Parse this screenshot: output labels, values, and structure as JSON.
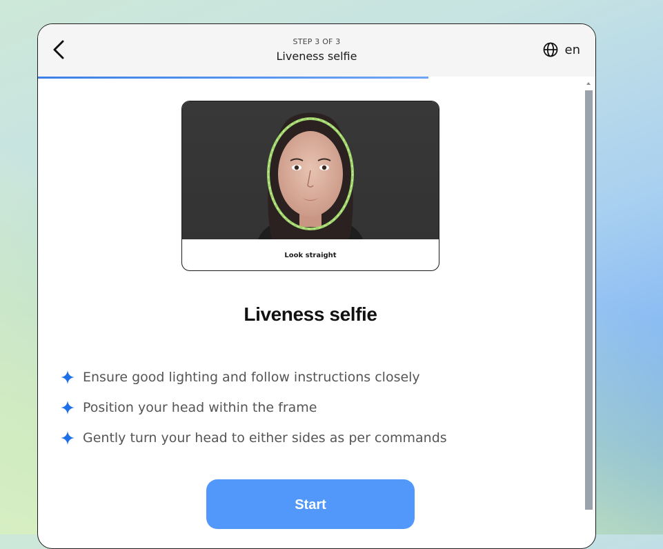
{
  "header": {
    "step": "STEP 3 OF 3",
    "title": "Liveness selfie",
    "language": "en",
    "back_icon": "chevron-left-icon",
    "language_icon": "globe-icon",
    "progress": 0.7
  },
  "preview": {
    "caption": "Look straight",
    "overlay_color": "#9fd46a"
  },
  "main": {
    "title": "Liveness selfie",
    "instructions": [
      "Ensure good lighting and follow instructions closely",
      "Position your head within the frame",
      "Gently turn your head to either sides as per commands"
    ],
    "bullet_icon": "sparkle-icon",
    "bullet_color": "#1f6fe8"
  },
  "actions": {
    "start_label": "Start"
  },
  "colors": {
    "accent": "#5298fa",
    "progress": "#3d7fe6"
  }
}
